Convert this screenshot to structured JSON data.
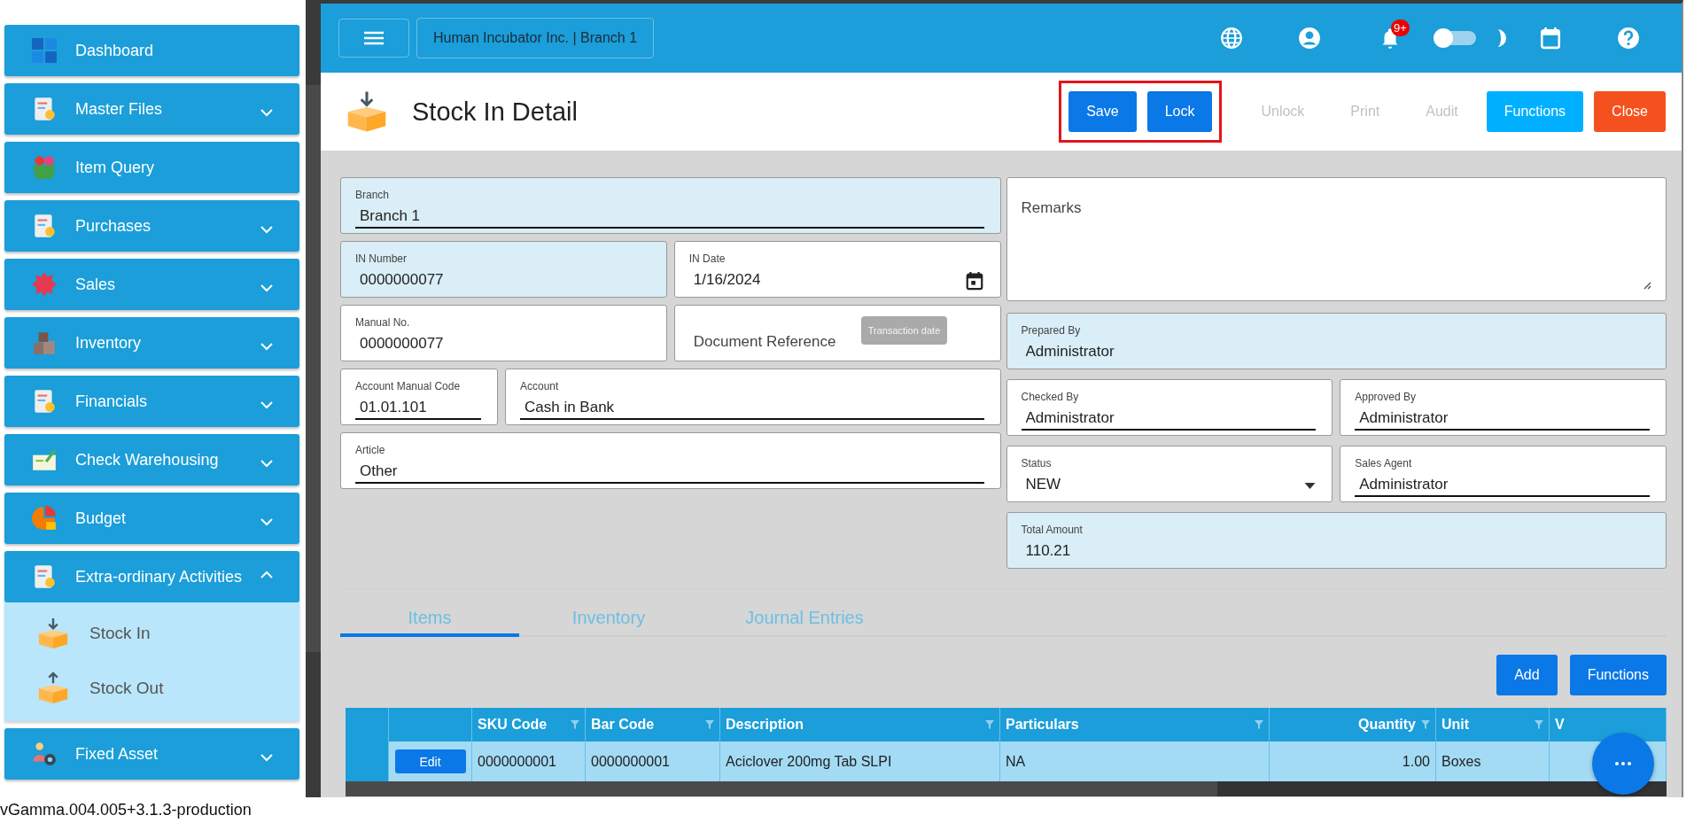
{
  "sidebar": {
    "items": [
      {
        "label": "Dashboard",
        "has_submenu": false
      },
      {
        "label": "Master Files",
        "has_submenu": true,
        "expanded": false
      },
      {
        "label": "Item Query",
        "has_submenu": false
      },
      {
        "label": "Purchases",
        "has_submenu": true,
        "expanded": false
      },
      {
        "label": "Sales",
        "has_submenu": true,
        "expanded": false
      },
      {
        "label": "Inventory",
        "has_submenu": true,
        "expanded": false
      },
      {
        "label": "Financials",
        "has_submenu": true,
        "expanded": false
      },
      {
        "label": "Check Warehousing",
        "has_submenu": true,
        "expanded": false
      },
      {
        "label": "Budget",
        "has_submenu": true,
        "expanded": false
      },
      {
        "label": "Extra-ordinary Activities",
        "has_submenu": true,
        "expanded": true,
        "children": [
          {
            "label": "Stock In"
          },
          {
            "label": "Stock Out"
          }
        ]
      },
      {
        "label": "Fixed Asset",
        "has_submenu": true,
        "expanded": false
      }
    ]
  },
  "header": {
    "company": "Human Incubator Inc. | Branch 1",
    "notification_badge": "9+",
    "dark_mode": {
      "on": false
    }
  },
  "page": {
    "title": "Stock In Detail",
    "highlighted_actions": [
      {
        "label": "Save",
        "kind": "primary",
        "disabled": false
      },
      {
        "label": "Lock",
        "kind": "primary",
        "disabled": false
      }
    ],
    "actions": [
      {
        "label": "Unlock",
        "kind": "text",
        "disabled": true
      },
      {
        "label": "Print",
        "kind": "text",
        "disabled": true
      },
      {
        "label": "Audit",
        "kind": "text",
        "disabled": true
      },
      {
        "label": "Functions",
        "kind": "accent",
        "disabled": false
      },
      {
        "label": "Close",
        "kind": "danger",
        "disabled": false
      }
    ]
  },
  "form": {
    "left_rows": [
      [
        {
          "label": "Branch",
          "value": "Branch 1",
          "kind": "text",
          "readonly": true,
          "underlined": true
        }
      ],
      [
        {
          "label": "IN Number",
          "value": "0000000077",
          "kind": "text",
          "readonly": true,
          "underlined": false
        },
        {
          "label": "IN Date",
          "value": "1/16/2024",
          "kind": "date",
          "readonly": false,
          "underlined": false
        }
      ],
      [
        {
          "label": "Manual No.",
          "value": "0000000077",
          "kind": "text",
          "readonly": false,
          "underlined": false
        },
        {
          "placeholder": "Document Reference",
          "kind": "text",
          "readonly": false,
          "underlined": false,
          "tooltip": "Transaction date"
        }
      ],
      [
        {
          "label": "Account Manual Code",
          "value": "01.01.101",
          "kind": "text",
          "readonly": false,
          "underlined": true,
          "narrow": true
        },
        {
          "label": "Account",
          "value": "Cash in Bank",
          "kind": "text",
          "readonly": false,
          "underlined": true
        }
      ],
      [
        {
          "label": "Article",
          "value": "Other",
          "kind": "text",
          "readonly": false,
          "underlined": true
        }
      ]
    ],
    "right_rows": [
      [
        {
          "placeholder": "Remarks",
          "kind": "textarea",
          "readonly": false,
          "underlined": false
        }
      ],
      [
        {
          "label": "Prepared By",
          "value": "Administrator",
          "kind": "text",
          "readonly": true,
          "underlined": false
        }
      ],
      [
        {
          "label": "Checked By",
          "value": "Administrator",
          "kind": "text",
          "readonly": false,
          "underlined": true
        },
        {
          "label": "Approved By",
          "value": "Administrator",
          "kind": "text",
          "readonly": false,
          "underlined": true
        }
      ],
      [
        {
          "label": "Status",
          "value": "NEW",
          "kind": "select",
          "readonly": false,
          "underlined": false
        },
        {
          "label": "Sales Agent",
          "value": "Administrator",
          "kind": "text",
          "readonly": false,
          "underlined": true
        }
      ],
      [
        {
          "label": "Total Amount",
          "value": "110.21",
          "kind": "text",
          "readonly": true,
          "underlined": false
        }
      ]
    ]
  },
  "tabs": [
    {
      "label": "Items",
      "selected": true
    },
    {
      "label": "Inventory",
      "selected": false
    },
    {
      "label": "Journal Entries",
      "selected": false
    }
  ],
  "table_actions": [
    "Add",
    "Functions"
  ],
  "table": {
    "columns": [
      {
        "label": "SKU Code",
        "filter": true,
        "kind": "text"
      },
      {
        "label": "Bar Code",
        "filter": true,
        "kind": "text"
      },
      {
        "label": "Description",
        "filter": true,
        "kind": "text"
      },
      {
        "label": "Particulars",
        "filter": true,
        "kind": "text"
      },
      {
        "label": "Quantity",
        "filter": true,
        "kind": "number"
      },
      {
        "label": "Unit",
        "filter": true,
        "kind": "text"
      },
      {
        "label": "V",
        "kind": "text"
      }
    ],
    "rows": [
      {
        "action": "Edit",
        "cells": [
          "0000000001",
          "0000000001",
          "Aciclover 200mg Tab SLPI",
          "NA",
          "1.00",
          "Boxes",
          ""
        ]
      }
    ]
  },
  "version": "vGamma.004.005+3.1.3-production"
}
